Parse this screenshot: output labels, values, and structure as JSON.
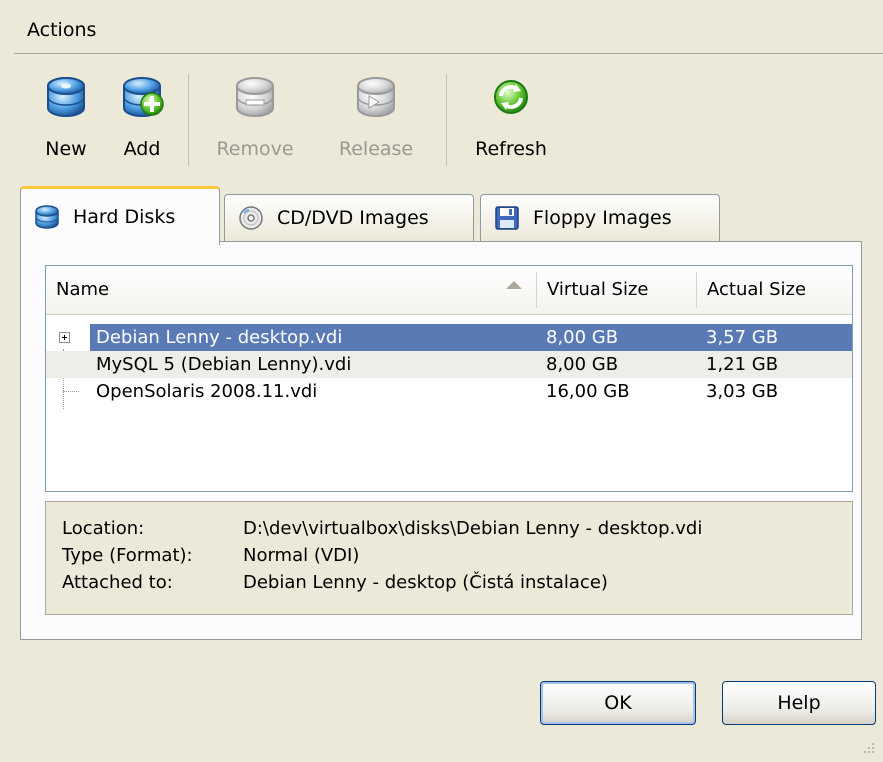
{
  "menubar": {
    "actions_label": "Actions"
  },
  "toolbar": {
    "new_label": "New",
    "add_label": "Add",
    "remove_label": "Remove",
    "release_label": "Release",
    "refresh_label": "Refresh"
  },
  "tabs": [
    {
      "label": "Hard Disks",
      "icon": "hard-disk-icon",
      "active": true
    },
    {
      "label": "CD/DVD Images",
      "icon": "cd-icon",
      "active": false
    },
    {
      "label": "Floppy Images",
      "icon": "floppy-icon",
      "active": false
    }
  ],
  "table": {
    "columns": [
      "Name",
      "Virtual Size",
      "Actual Size"
    ],
    "rows": [
      {
        "name": "Debian Lenny - desktop.vdi",
        "virtual": "8,00 GB",
        "actual": "3,57 GB",
        "selected": true
      },
      {
        "name": "MySQL 5 (Debian Lenny).vdi",
        "virtual": "8,00 GB",
        "actual": "1,21 GB"
      },
      {
        "name": "OpenSolaris 2008.11.vdi",
        "virtual": "16,00 GB",
        "actual": "3,03 GB"
      }
    ]
  },
  "info": {
    "location_label": "Location:",
    "location_value": "D:\\dev\\virtualbox\\disks\\Debian Lenny - desktop.vdi",
    "type_label": "Type (Format):",
    "type_value": "Normal (VDI)",
    "attached_label": "Attached to:",
    "attached_value": "Debian Lenny - desktop (Čistá instalace)"
  },
  "buttons": {
    "ok_label": "OK",
    "help_label": "Help"
  },
  "colors": {
    "selection": "#5a7ab6",
    "tab_highlight": "#ffc83c",
    "background": "#ece9d8"
  }
}
